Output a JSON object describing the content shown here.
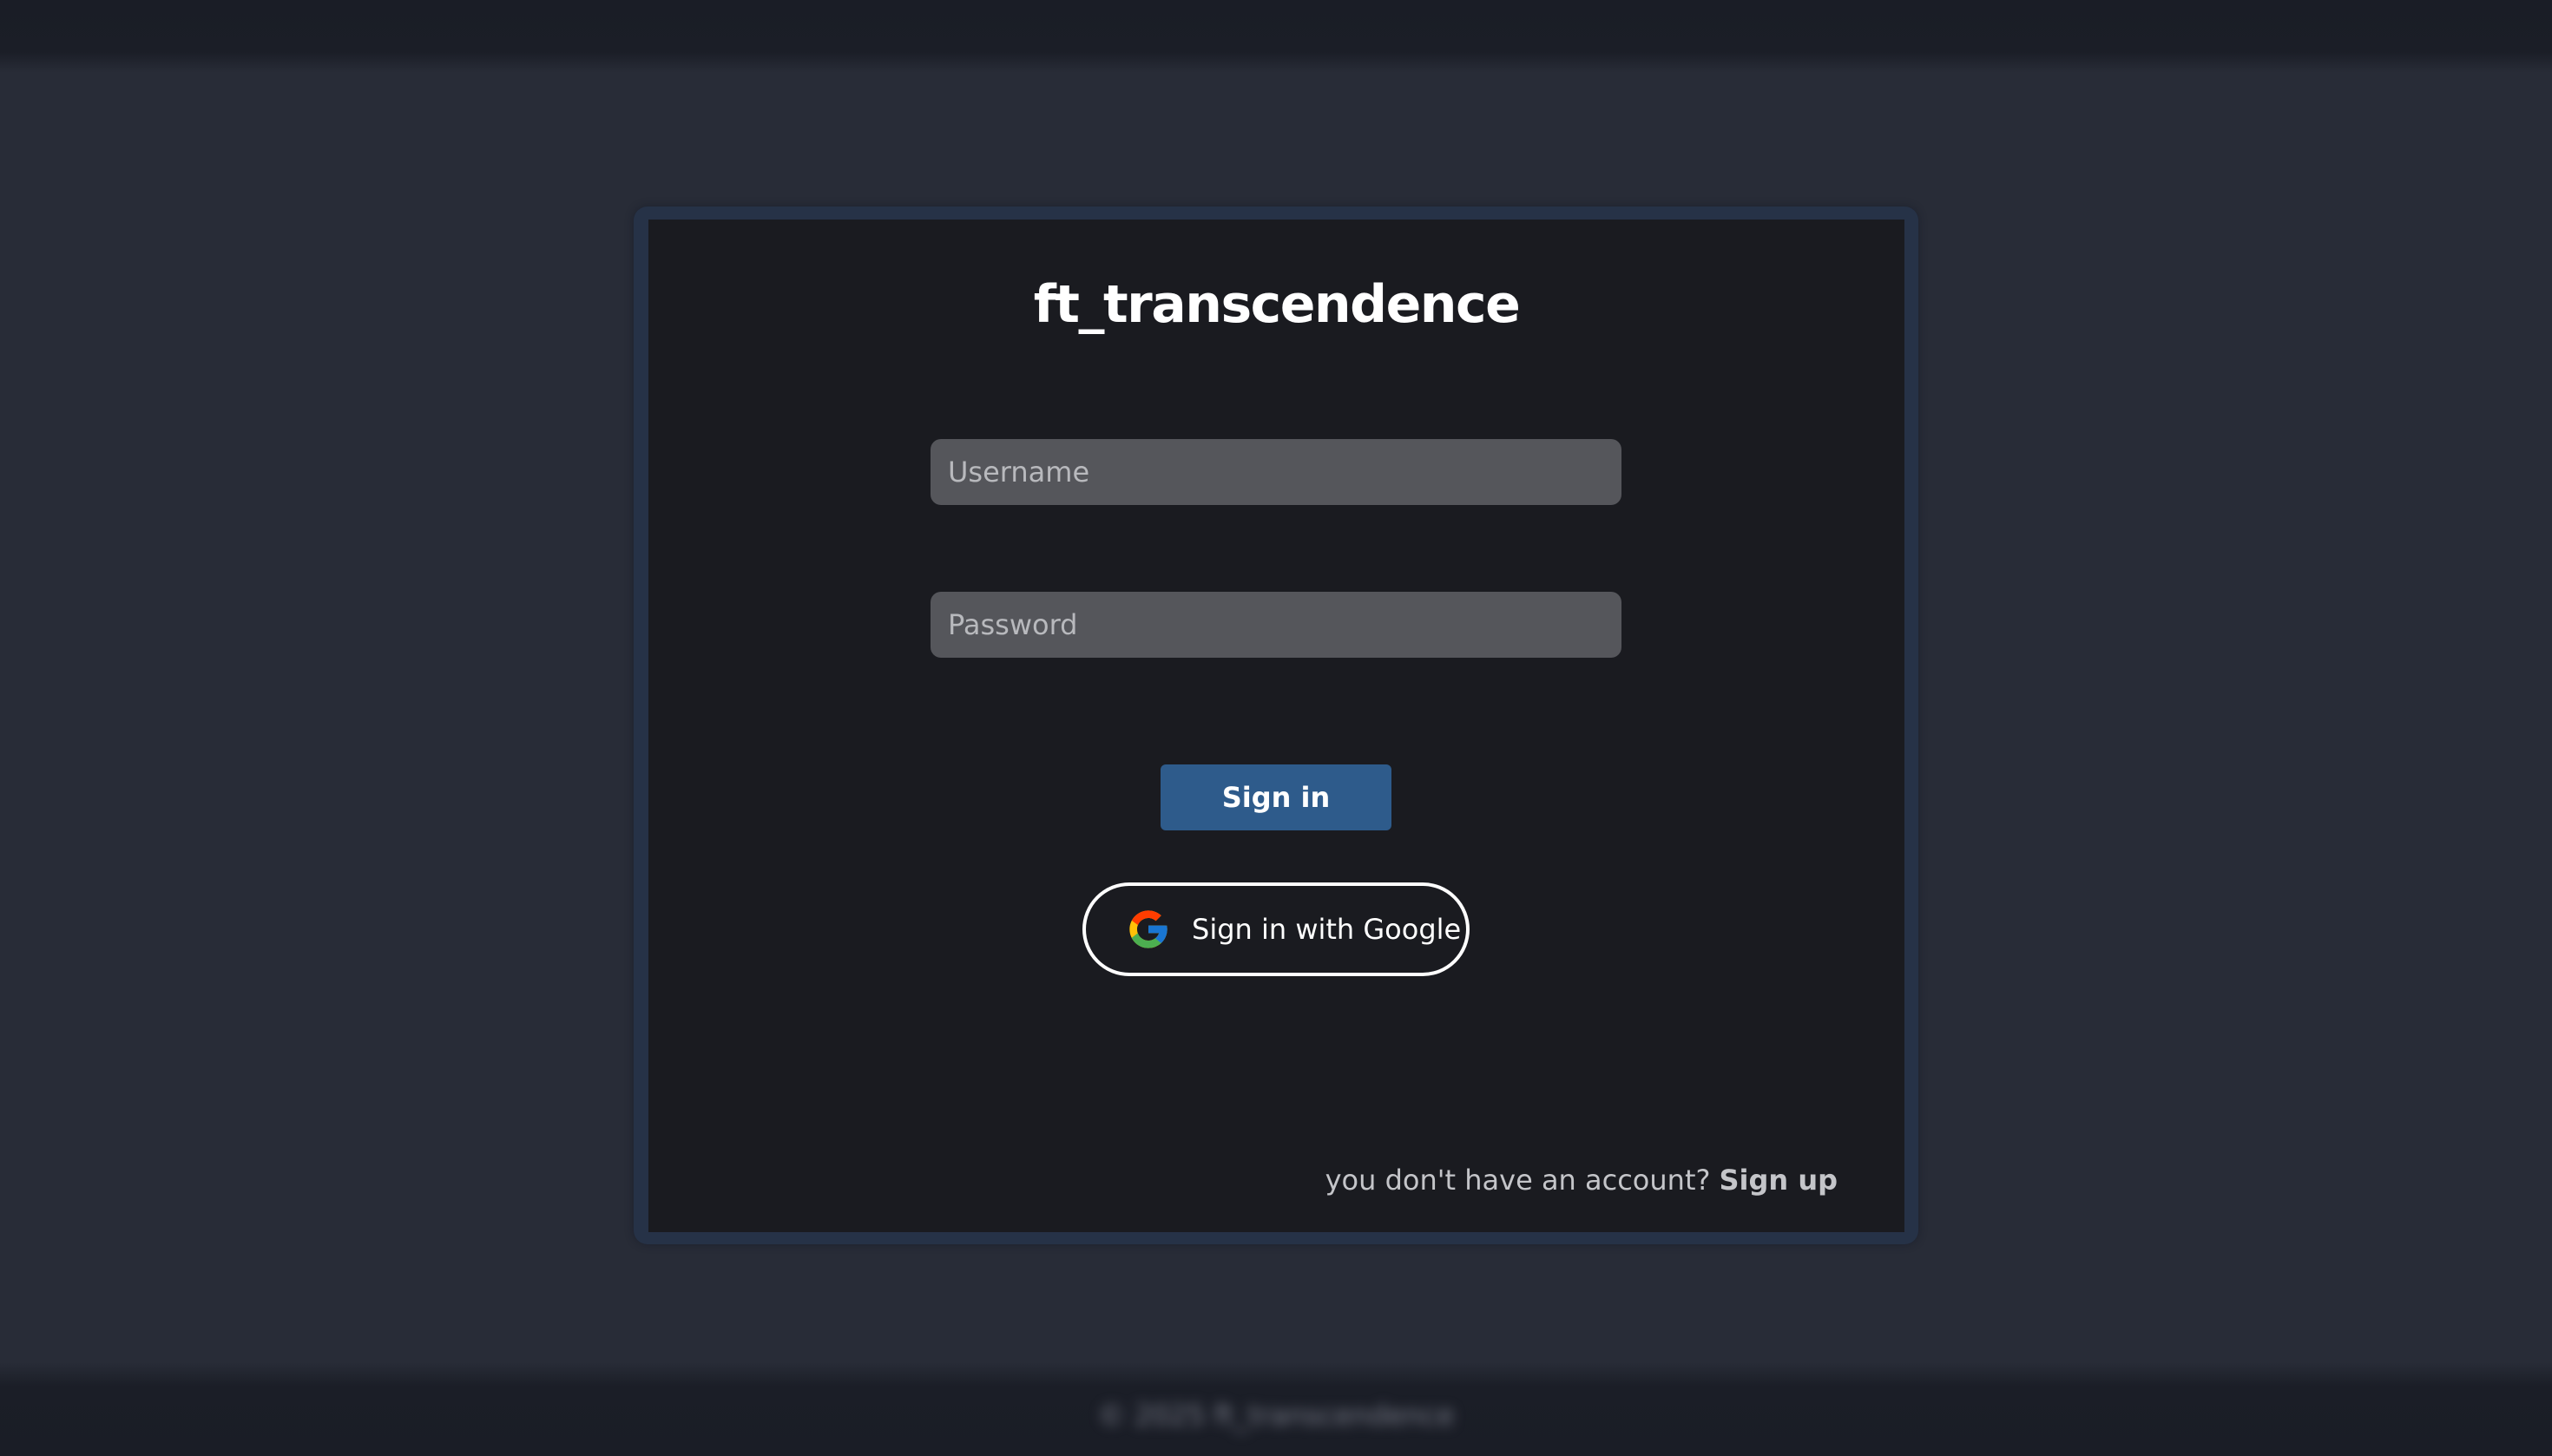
{
  "app": {
    "title": "ft_transcendence"
  },
  "login_form": {
    "username_placeholder": "Username",
    "password_placeholder": "Password",
    "signin_label": "Sign in",
    "google_label": "Sign in with Google",
    "google_icon": "google-g-icon",
    "signup_prompt": "you don't have an account?",
    "signup_link": "Sign up"
  },
  "footer": {
    "text": "© 2025 ft_transcendence"
  },
  "colors": {
    "page_background": "#282c37",
    "card_background": "#1a1b20",
    "card_border": "#263247",
    "input_background": "#55565b",
    "primary_button": "#2e5b8b"
  }
}
